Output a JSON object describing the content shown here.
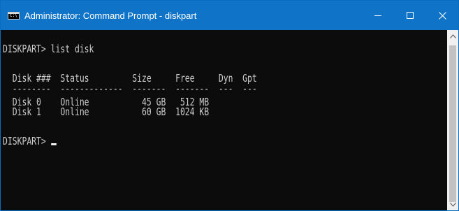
{
  "window": {
    "title": "Administrator: Command Prompt - diskpart",
    "icon_text": "C:\\",
    "accent_color": "#0f74c8"
  },
  "console": {
    "lines": [
      "DISKPART> list disk",
      "",
      "  Disk ###  Status         Size     Free     Dyn  Gpt",
      "  --------  -------------  -------  -------  ---  ---",
      "  Disk 0    Online           45 GB   512 MB",
      "  Disk 1    Online           60 GB  1024 KB",
      "",
      "DISKPART> "
    ],
    "disks": [
      {
        "disk": "Disk 0",
        "status": "Online",
        "size": "45 GB",
        "free": "512 MB",
        "dyn": "",
        "gpt": ""
      },
      {
        "disk": "Disk 1",
        "status": "Online",
        "size": "60 GB",
        "free": "1024 KB",
        "dyn": "",
        "gpt": ""
      }
    ],
    "text_color": "#cccccc",
    "background_color": "#0c0c0c"
  },
  "controls": {
    "minimize_icon": "minimize-icon",
    "maximize_icon": "maximize-icon",
    "close_icon": "close-icon"
  }
}
